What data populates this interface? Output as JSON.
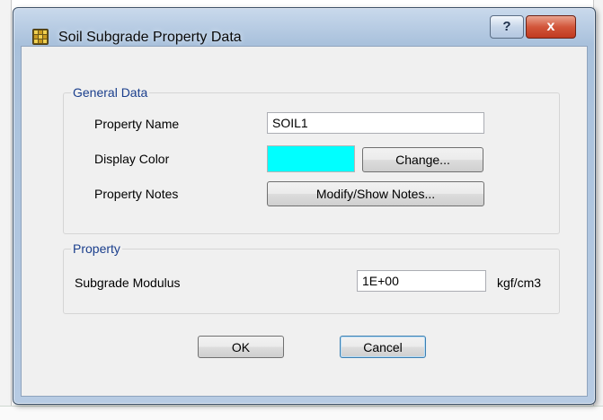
{
  "window": {
    "title": "Soil Subgrade Property Data",
    "help_label": "?",
    "close_label": "x"
  },
  "general_data": {
    "legend": "General Data",
    "property_name_label": "Property Name",
    "property_name_value": "SOIL1",
    "display_color_label": "Display Color",
    "display_color": "#00ffff",
    "change_label": "Change...",
    "property_notes_label": "Property Notes",
    "modify_notes_label": "Modify/Show Notes..."
  },
  "property": {
    "legend": "Property",
    "subgrade_modulus_label": "Subgrade Modulus",
    "subgrade_modulus_value": "1E+00",
    "subgrade_modulus_unit": "kgf/cm3"
  },
  "actions": {
    "ok_label": "OK",
    "cancel_label": "Cancel"
  }
}
